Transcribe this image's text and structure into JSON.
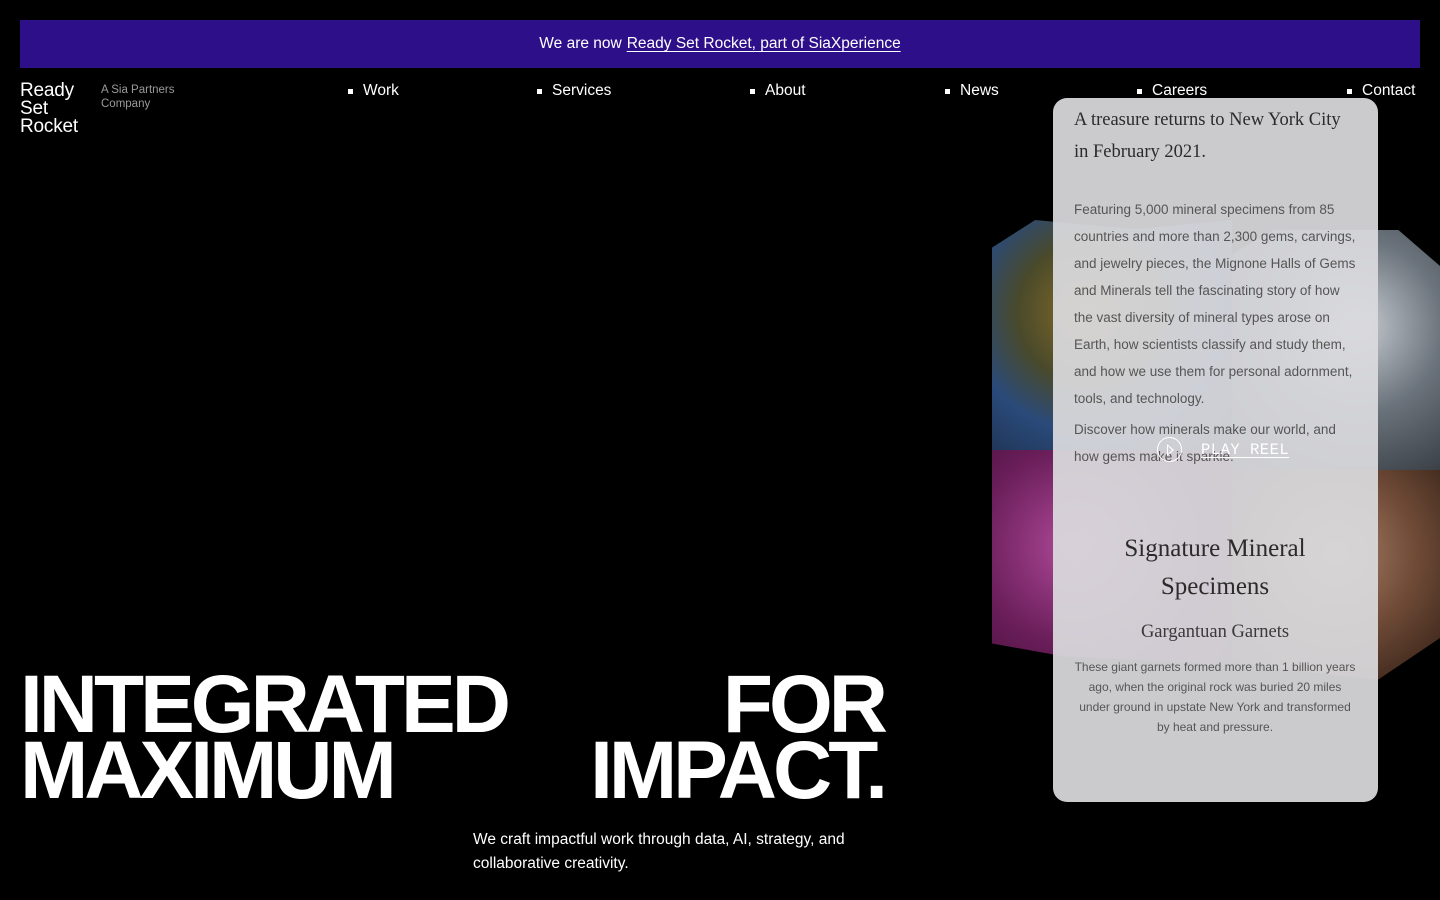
{
  "banner": {
    "prefix": "We are now",
    "link": "Ready Set Rocket, part of SiaXperience"
  },
  "logo": {
    "lines": [
      "Ready",
      "Set",
      "Rocket"
    ],
    "sub": "A Sia Partners Company"
  },
  "nav": [
    {
      "label": "Work"
    },
    {
      "label": "Services"
    },
    {
      "label": "About"
    },
    {
      "label": "News"
    },
    {
      "label": "Careers"
    },
    {
      "label": "Contact"
    }
  ],
  "card": {
    "heading": "A treasure returns to New York City in February 2021.",
    "body": "Featuring 5,000 mineral specimens from 85 countries and more than 2,300 gems, carvings, and jewelry pieces, the Mignone Halls of Gems and Minerals tell the fascinating story of how the vast diversity of mineral types arose on Earth, how scientists classify and study them, and how we use them for personal adornment, tools, and technology.",
    "body2": "Discover how minerals make our world, and how gems make it sparkle.",
    "title2": "Signature Mineral Specimens",
    "sub": "Gargantuan Garnets",
    "small": "These giant garnets formed more than 1 billion years ago, when the original rock was buried 20 miles under ground in upstate New York and transformed by heat and pressure."
  },
  "play": {
    "label": "PLAY REEL",
    "icon": "play-circle-icon"
  },
  "headline": {
    "left": [
      "INTEGRATED",
      "MAXIMUM"
    ],
    "right": [
      "FOR",
      "IMPACT."
    ]
  },
  "tagline": "We craft impactful work through data, AI, strategy, and collaborative creativity.",
  "colors": {
    "banner_bg": "#2e0f8a",
    "page_bg": "#000000",
    "text": "#ffffff"
  }
}
